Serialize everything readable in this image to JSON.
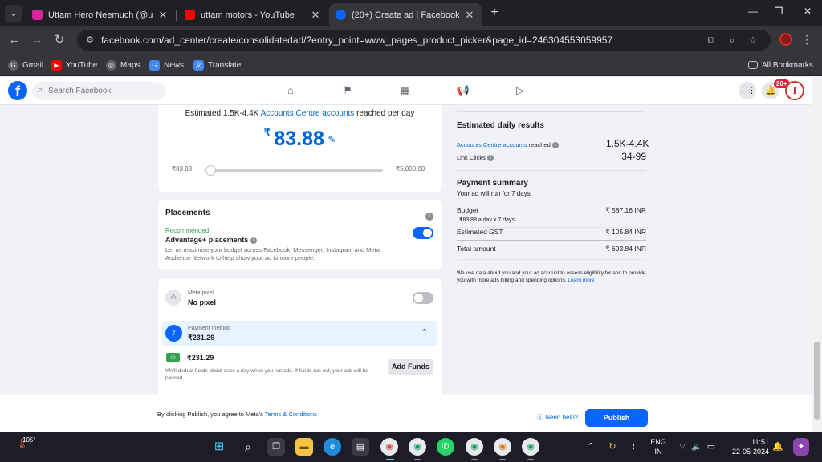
{
  "browser": {
    "tabs": [
      {
        "title": "Uttam Hero Neemuch (@uttam",
        "favicon_color": "#d6249f",
        "active": false
      },
      {
        "title": "uttam motors - YouTube",
        "favicon_color": "#ff0000",
        "active": false
      },
      {
        "title": "(20+) Create ad | Facebook",
        "favicon_color": "#0866ff",
        "active": true
      }
    ],
    "url": "facebook.com/ad_center/create/consolidatedad/?entry_point=www_pages_product_picker&page_id=246304553059957",
    "bookmarks": [
      {
        "label": "Gmail"
      },
      {
        "label": "YouTube"
      },
      {
        "label": "Maps"
      },
      {
        "label": "News"
      },
      {
        "label": "Translate"
      }
    ],
    "all_bookmarks": "All Bookmarks"
  },
  "fb_header": {
    "search_placeholder": "Search Facebook",
    "notification_badge": "20+",
    "avatar_letter": "I"
  },
  "budget": {
    "estimate_prefix": "Estimated 1.5K-4.4K",
    "estimate_link": "Accounts Centre accounts",
    "estimate_suffix": "reached per day",
    "currency": "₹",
    "amount": "83.88",
    "slider_min": "₹83.88",
    "slider_max": "₹5,000.00",
    "slider_fraction": 0.0
  },
  "placements": {
    "title": "Placements",
    "recommended": "Recommended",
    "option": "Advantage+ placements",
    "description": "Let us maximise your budget across Facebook, Messenger, Instagram and Meta Audience Network to help show your ad to more people.",
    "enabled": true
  },
  "pixel": {
    "label": "Meta pixel",
    "value": "No pixel",
    "enabled": false
  },
  "payment": {
    "label": "Payment method",
    "value": "₹231.29",
    "balance": "₹231.29",
    "note": "We'll deduct funds about once a day when you run ads. If funds run out, your ads will be paused.",
    "add_funds": "Add Funds"
  },
  "results": {
    "title": "Estimated daily results",
    "reach_link": "Accounts Centre accounts",
    "reach_suffix": "reached",
    "reach_value": "1.5K-4.4K",
    "clicks_label": "Link Clicks",
    "clicks_value": "34-99"
  },
  "summary": {
    "title": "Payment summary",
    "subtitle": "Your ad will run for 7 days.",
    "budget_label": "Budget",
    "budget_detail": "₹83.88 a day x 7 days.",
    "budget_value": "₹ 587.16 INR",
    "gst_label": "Estimated GST",
    "gst_value": "₹ 105.84 INR",
    "total_label": "Total amount",
    "total_value": "₹ 693.84 INR",
    "disclaimer": "We use data about you and your ad account to assess eligibility for and to provide you with more ads billing and spending options.",
    "learn_more": "Learn more"
  },
  "footer": {
    "agree_text": "By clicking Publish, you agree to Meta's",
    "terms": "Terms & Conditions",
    "help": "Need help?",
    "publish": "Publish"
  },
  "taskbar": {
    "weather": "105°",
    "lang1": "ENG",
    "lang2": "IN",
    "time": "11:51",
    "date": "22-05-2024"
  },
  "colors": {
    "fb_blue": "#0866ff",
    "link_blue": "#0064d1",
    "toggle_on": "#0866ff",
    "payment_highlight": "#e7f3ff"
  }
}
